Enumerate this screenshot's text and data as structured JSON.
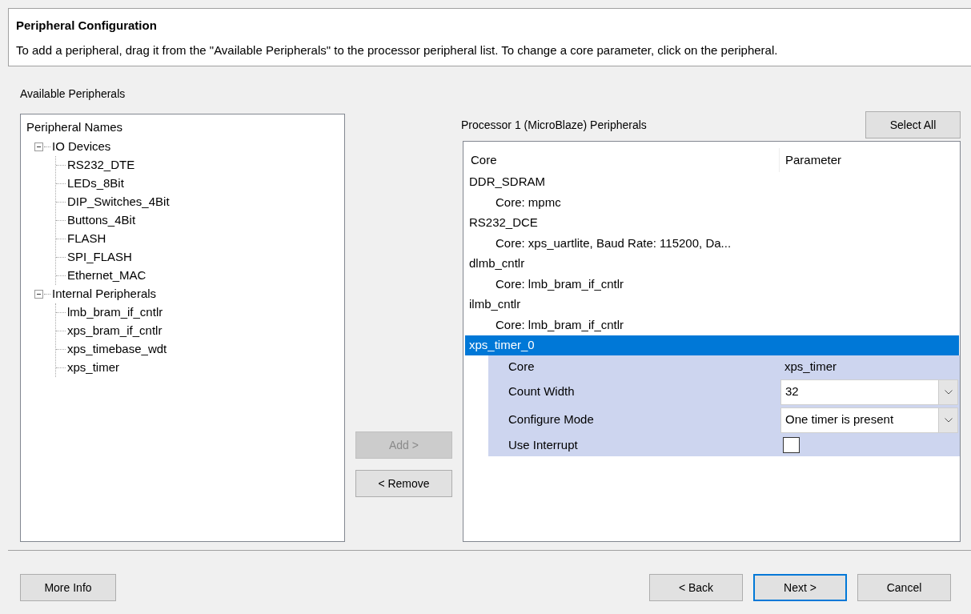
{
  "header": {
    "title": "Peripheral Configuration",
    "description": "To add a peripheral, drag it from the \"Available Peripherals\" to the processor peripheral list. To change a core parameter, click on the peripheral."
  },
  "available": {
    "label": "Available Peripherals",
    "column": "Peripheral Names",
    "tree": [
      {
        "label": "IO Devices",
        "expanded": true,
        "children": [
          {
            "label": "RS232_DTE"
          },
          {
            "label": "LEDs_8Bit"
          },
          {
            "label": "DIP_Switches_4Bit"
          },
          {
            "label": "Buttons_4Bit"
          },
          {
            "label": "FLASH"
          },
          {
            "label": "SPI_FLASH"
          },
          {
            "label": "Ethernet_MAC"
          }
        ]
      },
      {
        "label": "Internal Peripherals",
        "expanded": true,
        "children": [
          {
            "label": "lmb_bram_if_cntlr"
          },
          {
            "label": "xps_bram_if_cntlr"
          },
          {
            "label": "xps_timebase_wdt"
          },
          {
            "label": "xps_timer"
          }
        ]
      }
    ]
  },
  "transfer_buttons": [
    {
      "label": "Add >",
      "disabled": true
    },
    {
      "label": "< Remove",
      "disabled": false
    }
  ],
  "processor": {
    "label": "Processor 1 (MicroBlaze) Peripherals",
    "select_all": "Select All",
    "columns": [
      "Core",
      "Parameter"
    ],
    "rows": [
      {
        "name": "DDR_SDRAM",
        "detail": "Core: mpmc",
        "selected": false
      },
      {
        "name": "RS232_DCE",
        "detail": "Core: xps_uartlite, Baud Rate: 115200, Da...",
        "selected": false
      },
      {
        "name": "dlmb_cntlr",
        "detail": "Core: lmb_bram_if_cntlr",
        "selected": false
      },
      {
        "name": "ilmb_cntlr",
        "detail": "Core: lmb_bram_if_cntlr",
        "selected": false
      },
      {
        "name": "xps_timer_0",
        "selected": true,
        "params": [
          {
            "kind": "text",
            "label": "Core",
            "value": "xps_timer"
          },
          {
            "kind": "dropdown",
            "label": "Count Width",
            "value": "32"
          },
          {
            "kind": "dropdown",
            "label": "Configure Mode",
            "value": "One timer is present"
          },
          {
            "kind": "checkbox",
            "label": "Use Interrupt",
            "checked": false
          }
        ]
      }
    ]
  },
  "footer": {
    "left": [
      {
        "label": "More Info",
        "default": false
      }
    ],
    "right": [
      {
        "label": "< Back",
        "default": false
      },
      {
        "label": "Next >",
        "default": true
      },
      {
        "label": "Cancel",
        "default": false
      }
    ]
  }
}
